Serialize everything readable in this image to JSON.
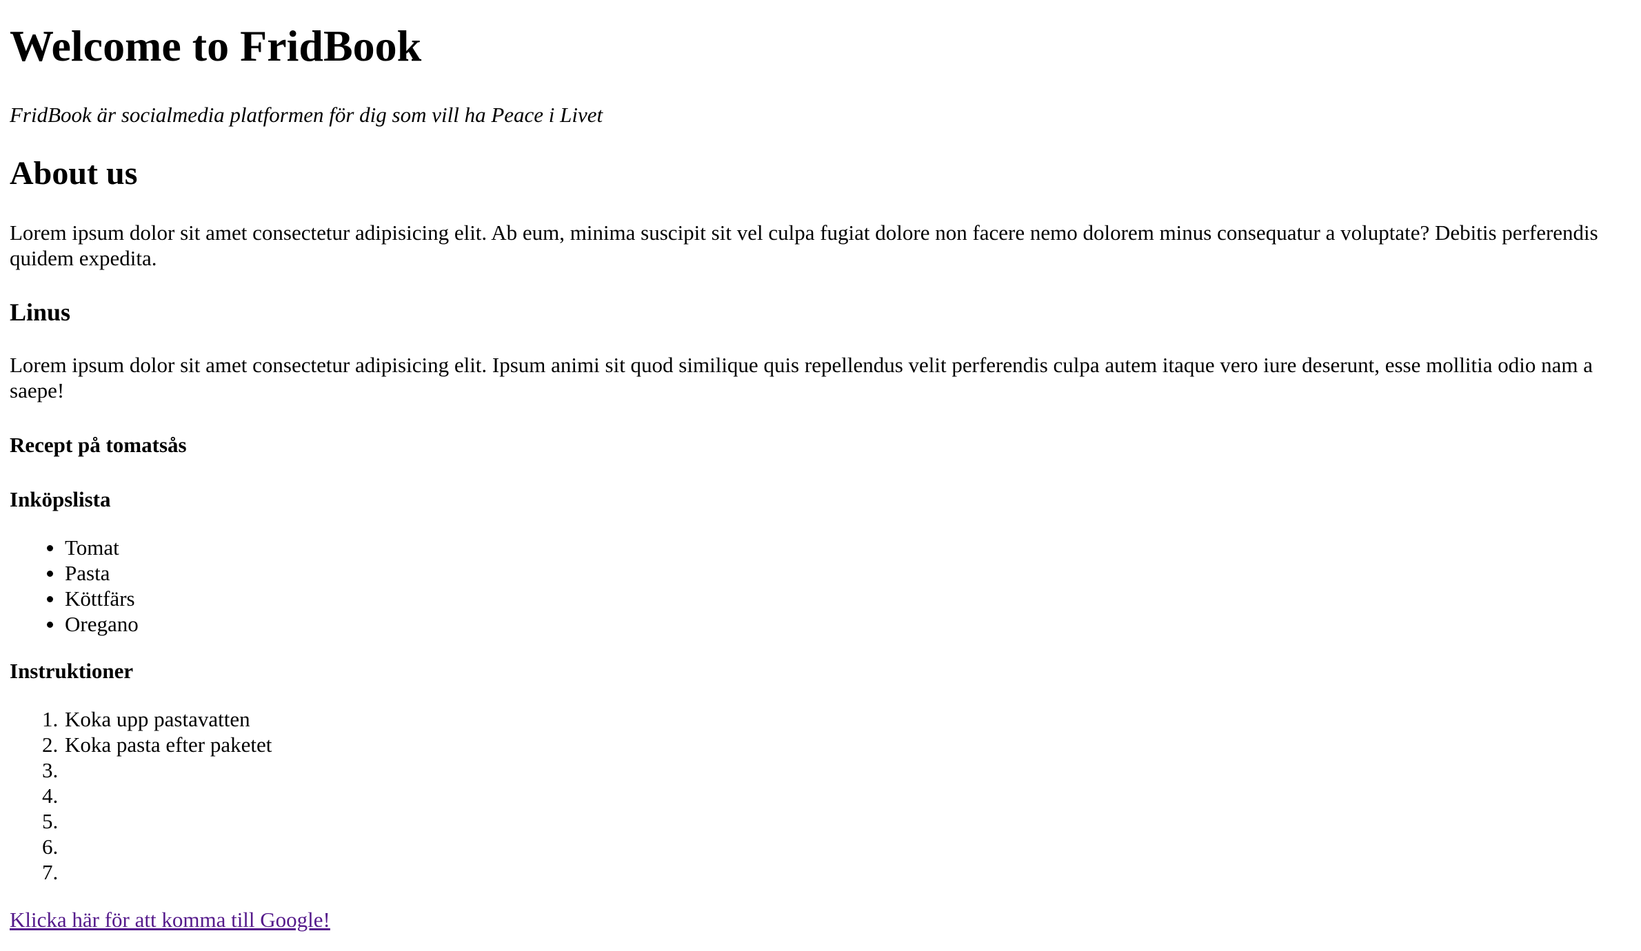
{
  "page": {
    "title": "Welcome to FridBook",
    "tagline": "FridBook är socialmedia platformen för dig som vill ha Peace i Livet"
  },
  "about": {
    "heading": "About us",
    "paragraph_line1": "Lorem ipsum dolor sit amet consectetur adipisicing elit. Ab eum, minima suscipit sit vel culpa fugiat dolore non facere nemo dolorem minus consequatur a voluptate? Debitis perferendis",
    "paragraph_line2": "quidem expedita."
  },
  "linus": {
    "heading": "Linus",
    "paragraph_line1": "Lorem ipsum dolor sit amet consectetur adipisicing elit. Ipsum animi sit quod similique quis repellendus velit perferendis culpa autem itaque vero iure deserunt, esse mollitia odio nam a",
    "paragraph_line2": "saepe!"
  },
  "recipe": {
    "heading": "Recept på tomatsås",
    "shopping": {
      "heading": "Inköpslista",
      "items": [
        "Tomat",
        "Pasta",
        "Köttfärs",
        "Oregano"
      ]
    },
    "instructions": {
      "heading": "Instruktioner",
      "steps": [
        {
          "number": "1.",
          "text": "Koka upp pastavatten"
        },
        {
          "number": "2.",
          "text": "Koka pasta efter paketet"
        },
        {
          "number": "3.",
          "text": ""
        },
        {
          "number": "4.",
          "text": ""
        },
        {
          "number": "5.",
          "text": ""
        },
        {
          "number": "6.",
          "text": ""
        },
        {
          "number": "7.",
          "text": ""
        }
      ]
    }
  },
  "footer": {
    "google_link": "Klicka här för att komma till Google!"
  },
  "colors": {
    "text": "#000000",
    "visited_link": "#551a8b",
    "background": "#ffffff"
  }
}
